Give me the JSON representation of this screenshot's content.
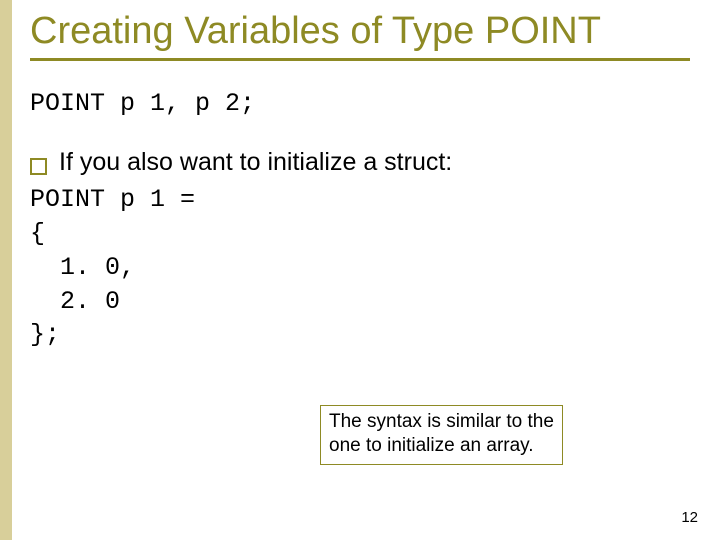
{
  "title": "Creating Variables of Type POINT",
  "code1": "POINT p 1, p 2;",
  "bullet_text": "If you also want to initialize a struct:",
  "code2_line1": "POINT p 1 =",
  "code2_line2": "{",
  "code2_line3": "  1. 0,",
  "code2_line4": "  2. 0",
  "code2_line5": "};",
  "callout_line1": "The syntax is similar to the",
  "callout_line2": "one to initialize an array.",
  "page_number": "12"
}
